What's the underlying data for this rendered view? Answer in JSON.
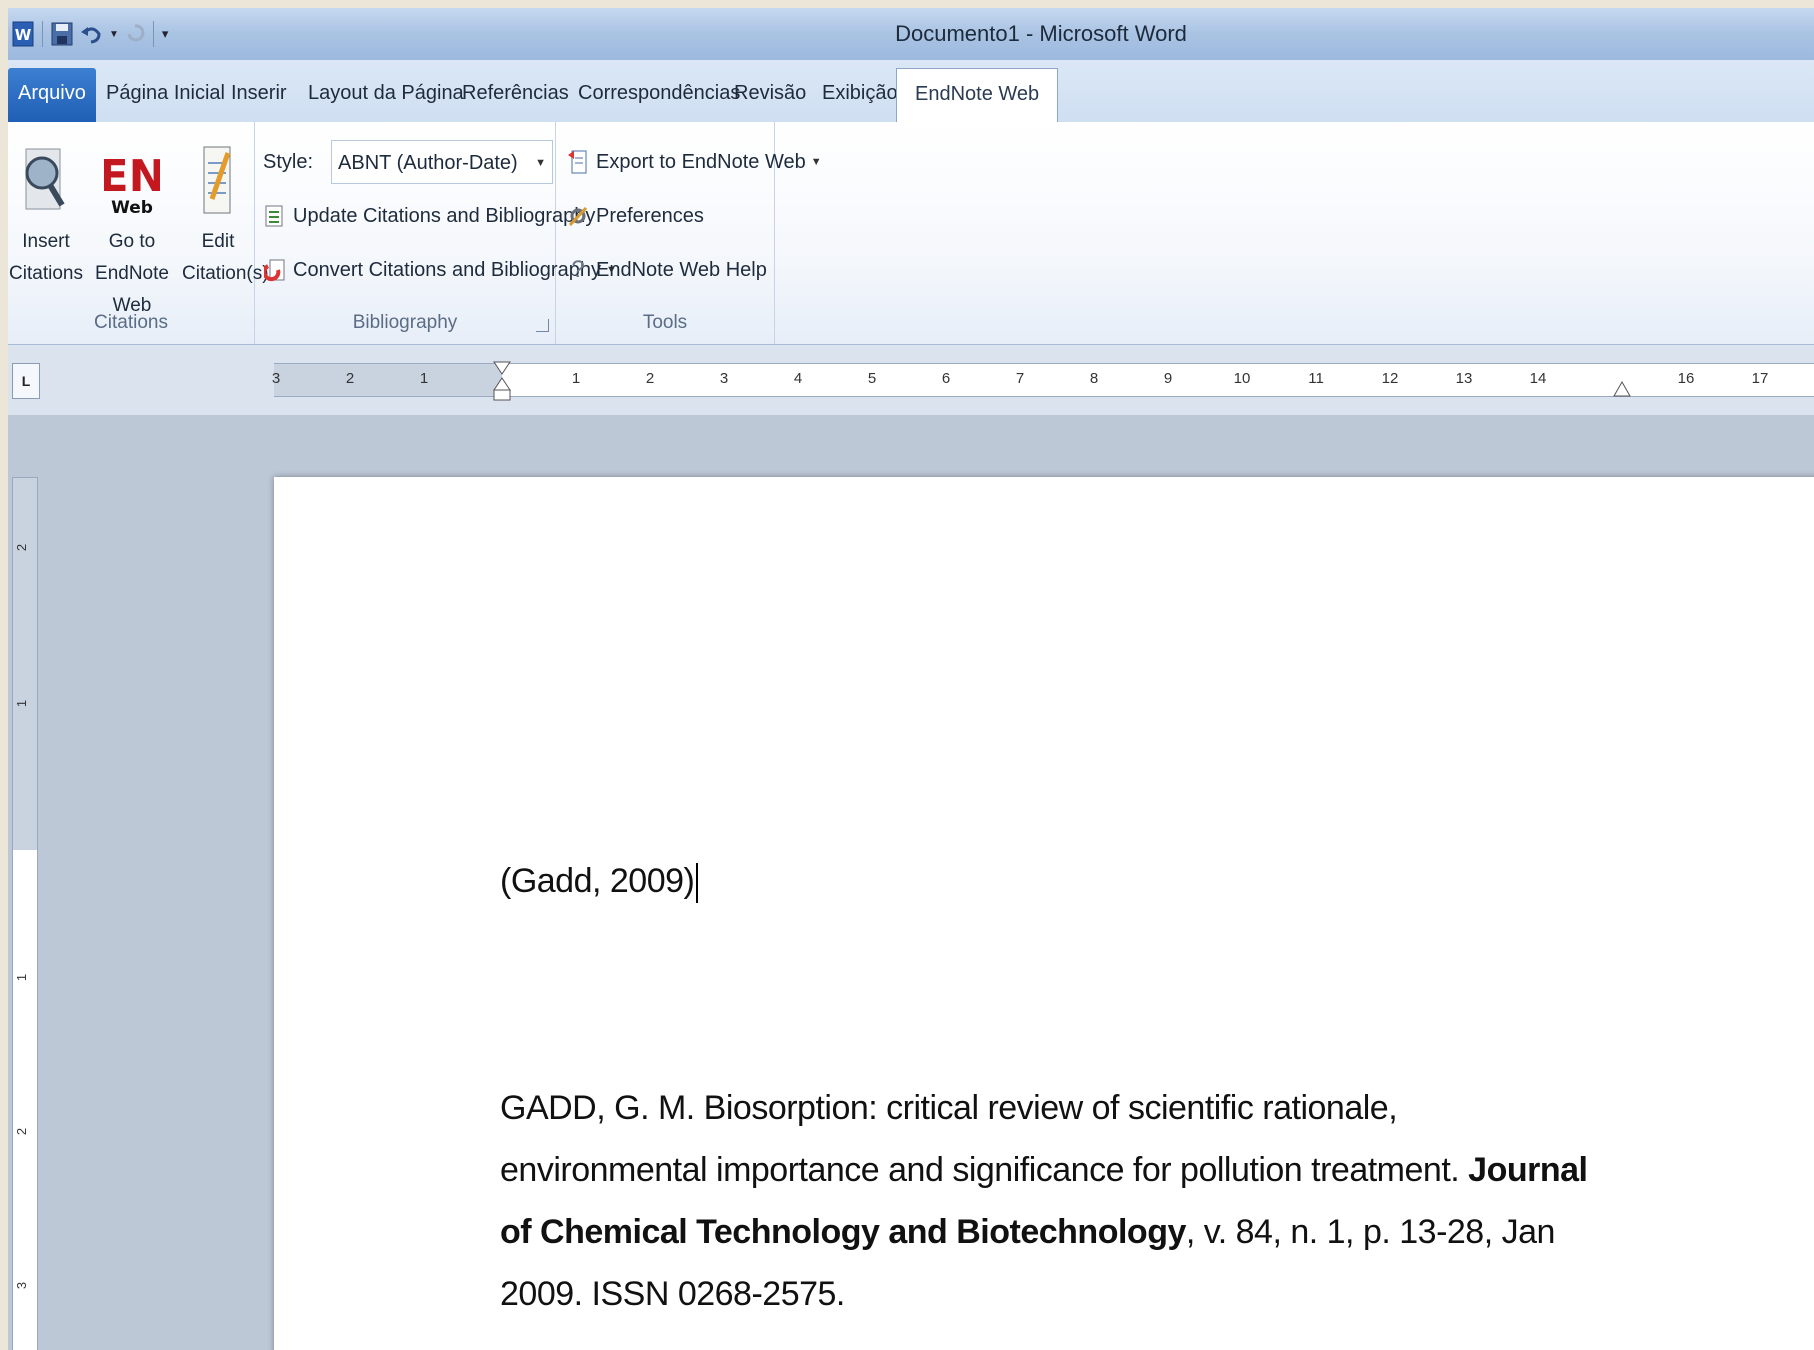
{
  "window": {
    "title": "Documento1 - Microsoft Word"
  },
  "tabs": [
    {
      "label": "Arquivo"
    },
    {
      "label": "Página Inicial"
    },
    {
      "label": "Inserir"
    },
    {
      "label": "Layout da Página"
    },
    {
      "label": "Referências"
    },
    {
      "label": "Correspondências"
    },
    {
      "label": "Revisão"
    },
    {
      "label": "Exibição"
    },
    {
      "label": "EndNote Web"
    }
  ],
  "ribbon": {
    "citations": {
      "label": "Citations",
      "insert_line1": "Insert",
      "insert_line2": "Citations",
      "goto_line1": "Go to",
      "goto_line2": "EndNote Web",
      "edit_line1": "Edit",
      "edit_line2": "Citation(s)",
      "en_logo": "EN",
      "en_logo_sub": "Web"
    },
    "bibliography": {
      "label": "Bibliography",
      "style_label": "Style:",
      "style_value": "ABNT (Author-Date)",
      "update": "Update Citations and Bibliography",
      "convert": "Convert Citations and Bibliography"
    },
    "tools": {
      "label": "Tools",
      "export": "Export to EndNote Web",
      "preferences": "Preferences",
      "help": "EndNote Web Help"
    }
  },
  "document": {
    "citation": "(Gadd, 2009)",
    "bib_part1": "GADD, G. M. Biosorption: critical review of scientific rationale, environmental importance and significance for pollution treatment. ",
    "bib_journal": "Journal of Chemical Technology and Biotechnology",
    "bib_part2": ", v. 84, n. 1, p. 13-28, Jan 2009. ISSN 0268-2575."
  },
  "ruler": {
    "left_marks": [
      "3",
      "2",
      "1"
    ],
    "marks": [
      "1",
      "2",
      "3",
      "4",
      "5",
      "6",
      "7",
      "8",
      "9",
      "10",
      "11",
      "12",
      "13",
      "14",
      "16",
      "17"
    ]
  },
  "vruler": {
    "marks": [
      "2",
      "1",
      "1",
      "2",
      "3"
    ]
  },
  "icons": [
    "word-app-icon",
    "save-icon",
    "undo-icon",
    "redo-icon",
    "customize-qat-icon",
    "magnifier-icon",
    "endnote-web-logo",
    "edit-doc-icon",
    "update-icon",
    "convert-icon",
    "export-icon",
    "preferences-icon",
    "help-icon"
  ],
  "colors": {
    "file_tab": "#2a6bc4",
    "en_red": "#c3181f",
    "title_bar": "#a9c3e3"
  }
}
